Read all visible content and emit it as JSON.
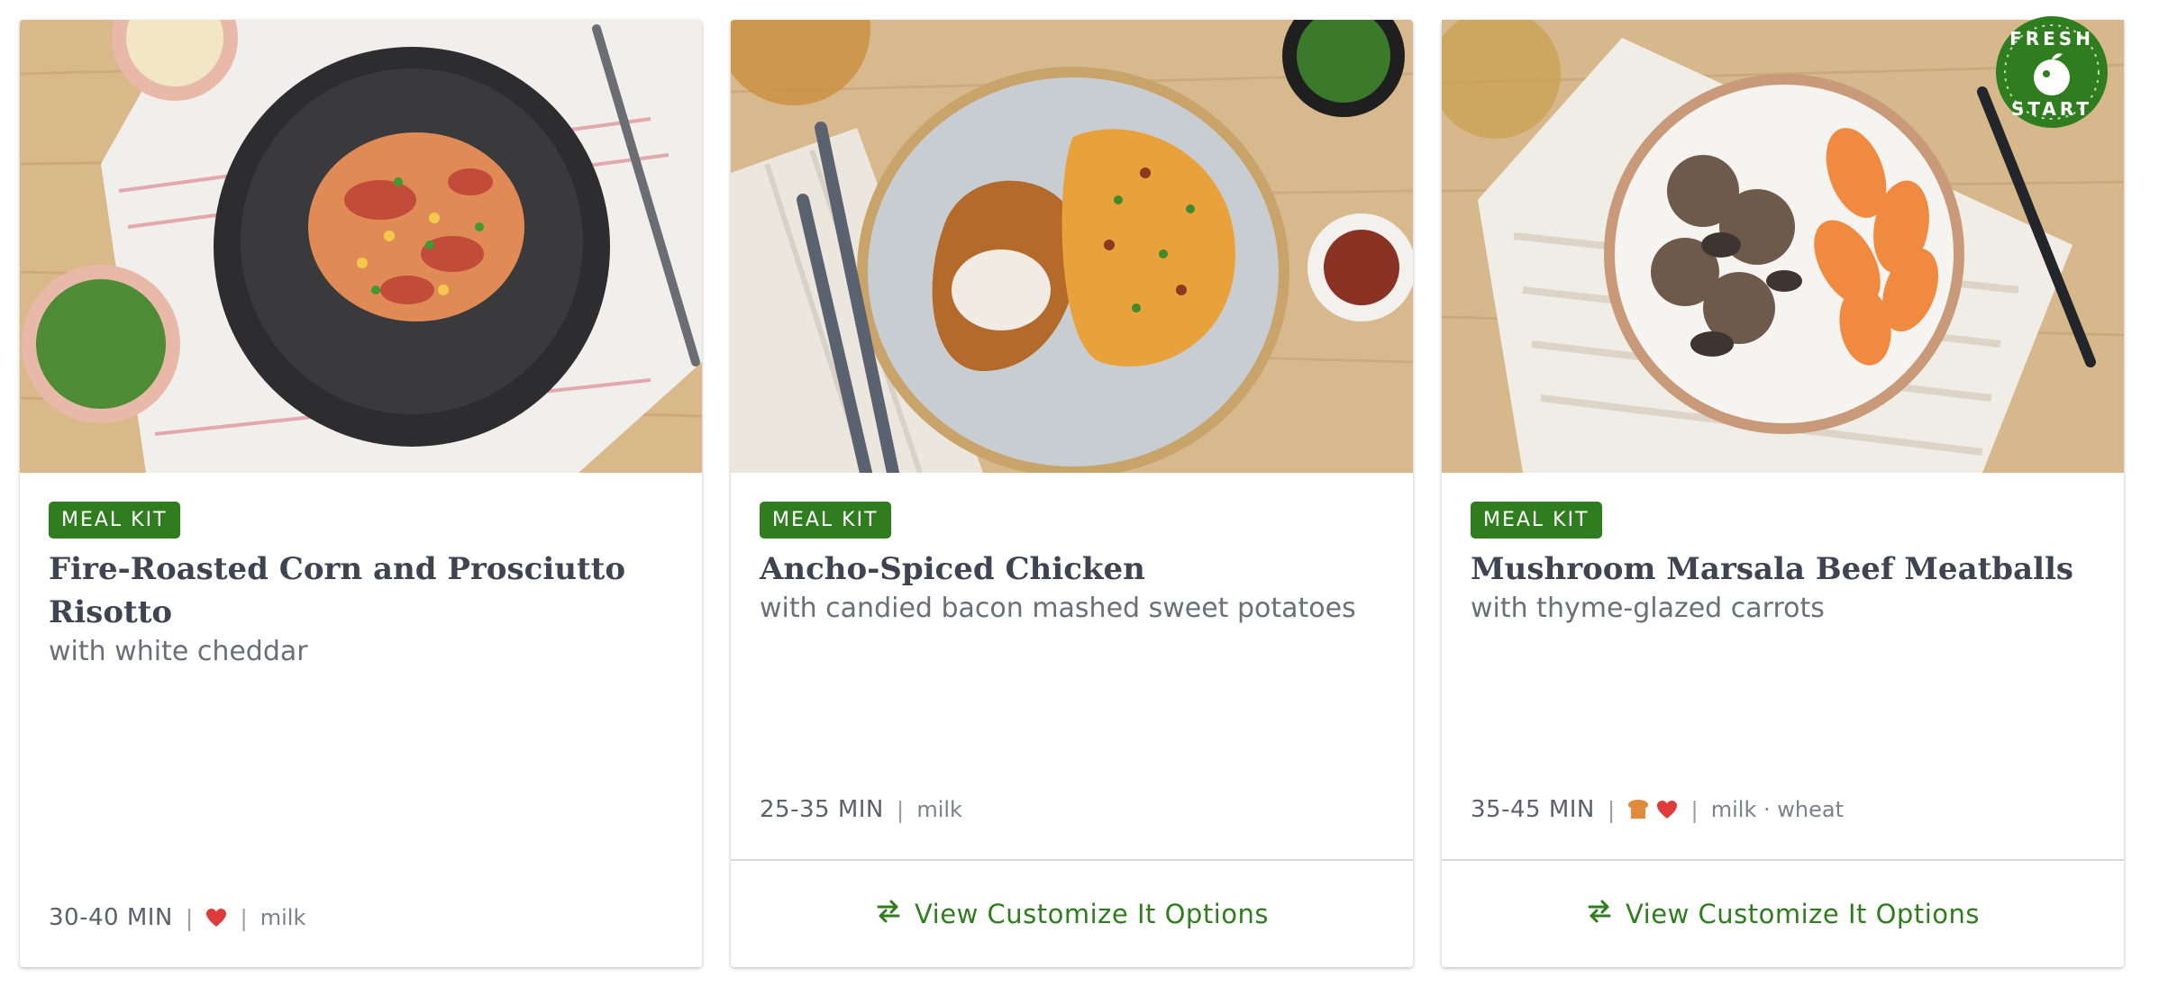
{
  "colors": {
    "brand_green": "#2f7d1e",
    "heart_red": "#e03b3b",
    "wheat_orange": "#e08a3c"
  },
  "cards": [
    {
      "badge": "MEAL KIT",
      "title": "Fire-Roasted Corn and Prosciutto Risotto",
      "subtitle": "with white cheddar",
      "time": "30-40 MIN",
      "icons": [
        "heart-icon"
      ],
      "allergens": "milk"
    },
    {
      "badge": "MEAL KIT",
      "title": "Ancho-Spiced Chicken",
      "subtitle": "with candied bacon mashed sweet potatoes",
      "time": "25-35 MIN",
      "icons": [],
      "allergens": "milk",
      "action_label": "View Customize It Options"
    },
    {
      "badge": "MEAL KIT",
      "title": "Mushroom Marsala Beef Meatballs",
      "subtitle": "with thyme-glazed carrots",
      "time": "35-45 MIN",
      "icons": [
        "bread-icon",
        "heart-icon"
      ],
      "allergens": "milk · wheat",
      "action_label": "View Customize It Options",
      "corner_badge": {
        "line1": "FRESH",
        "line2": "START"
      }
    }
  ]
}
